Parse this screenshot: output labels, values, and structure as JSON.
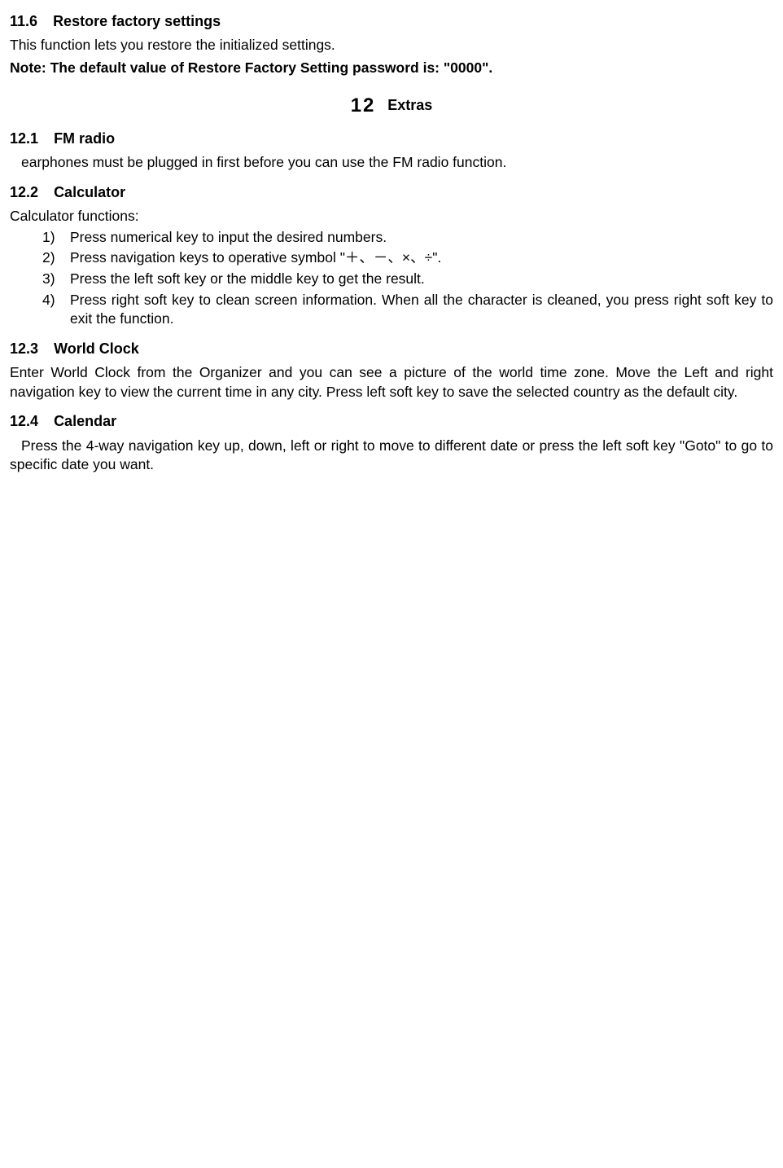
{
  "s11_6": {
    "num": "11.6",
    "title": "Restore factory settings",
    "p1": "This function lets you restore the initialized settings.",
    "p2": "Note: The default value of Restore Factory Setting password is: \"0000\"."
  },
  "chapter12": {
    "num": "12",
    "title": "Extras"
  },
  "s12_1": {
    "num": "12.1",
    "title": "FM radio",
    "p1": "earphones must be plugged in first before you can use the FM radio function."
  },
  "s12_2": {
    "num": "12.2",
    "title": "Calculator",
    "intro": "Calculator functions:",
    "items": [
      {
        "m": "1)",
        "t": "Press numerical key to input the desired numbers."
      },
      {
        "m": "2)",
        "t": "Press navigation keys to operative symbol \"＋、－、×、÷\"."
      },
      {
        "m": "3)",
        "t": "Press the left soft key or the middle key to get the result."
      },
      {
        "m": "4)",
        "t": "Press right soft key to clean screen information. When all the character is cleaned, you press right soft key to exit the function."
      }
    ]
  },
  "s12_3": {
    "num": "12.3",
    "title": "World Clock",
    "p1": "Enter World Clock from the Organizer and you can see a picture of the world time zone. Move the Left and right navigation key to view the current time in any city. Press left soft key to save the selected country as the default city."
  },
  "s12_4": {
    "num": "12.4",
    "title": "Calendar",
    "p1": "Press the 4-way navigation key up, down, left or right to move to different date or press the left soft key \"Goto\" to go to specific date you want."
  }
}
